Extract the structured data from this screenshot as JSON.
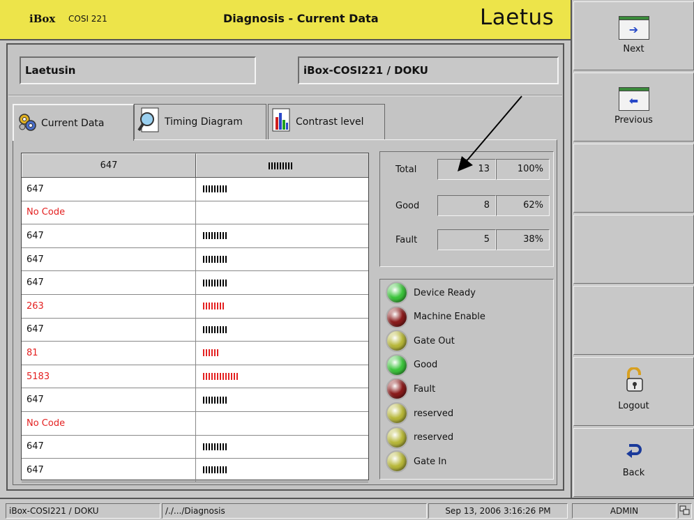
{
  "header": {
    "brand": "iBox",
    "model": "COSI 221",
    "title": "Diagnosis - Current Data",
    "logo": "Laetus",
    "accent_color": "#ede44a"
  },
  "fields": {
    "left": "Laetusin",
    "right": "iBox-COSI221 / DOKU"
  },
  "tabs": [
    {
      "label": "Current Data",
      "icon": "gears-icon",
      "active": true
    },
    {
      "label": "Timing Diagram",
      "icon": "magnifier-icon",
      "active": false
    },
    {
      "label": "Contrast level",
      "icon": "bar-chart-icon",
      "active": false
    }
  ],
  "table": {
    "columns": [
      "647",
      "barcode"
    ],
    "rows": [
      {
        "code": "647",
        "status": "ok",
        "bars": 9
      },
      {
        "code": "No Code",
        "status": "error",
        "bars": 0
      },
      {
        "code": "647",
        "status": "ok",
        "bars": 9
      },
      {
        "code": "647",
        "status": "ok",
        "bars": 9
      },
      {
        "code": "647",
        "status": "ok",
        "bars": 9
      },
      {
        "code": "263",
        "status": "error",
        "bars": 8
      },
      {
        "code": "647",
        "status": "ok",
        "bars": 9
      },
      {
        "code": "81",
        "status": "error",
        "bars": 6
      },
      {
        "code": "5183",
        "status": "error",
        "bars": 13
      },
      {
        "code": "647",
        "status": "ok",
        "bars": 9
      },
      {
        "code": "No Code",
        "status": "error",
        "bars": 0
      },
      {
        "code": "647",
        "status": "ok",
        "bars": 9
      },
      {
        "code": "647",
        "status": "ok",
        "bars": 9
      }
    ],
    "error_color": "#e42020"
  },
  "stats": {
    "total": {
      "label": "Total",
      "count": "13",
      "pct": "100%"
    },
    "good": {
      "label": "Good",
      "count": "8",
      "pct": "62%"
    },
    "fault": {
      "label": "Fault",
      "count": "5",
      "pct": "38%"
    }
  },
  "leds": [
    {
      "label": "Device Ready",
      "color": "#3cc43c"
    },
    {
      "label": "Machine Enable",
      "color": "#8a1c1c"
    },
    {
      "label": "Gate Out",
      "color": "#b8b83a"
    },
    {
      "label": "Good",
      "color": "#3cc43c"
    },
    {
      "label": "Fault",
      "color": "#8a1c1c"
    },
    {
      "label": "reserved",
      "color": "#b8b83a"
    },
    {
      "label": "reserved",
      "color": "#b8b83a"
    },
    {
      "label": "Gate In",
      "color": "#b8b83a"
    }
  ],
  "sidebar": {
    "next": "Next",
    "previous": "Previous",
    "logout": "Logout",
    "back": "Back"
  },
  "statusbar": {
    "device": "iBox-COSI221 / DOKU",
    "path": "/./.../Diagnosis",
    "datetime": "Sep 13, 2006  3:16:26 PM",
    "user": "ADMIN"
  }
}
